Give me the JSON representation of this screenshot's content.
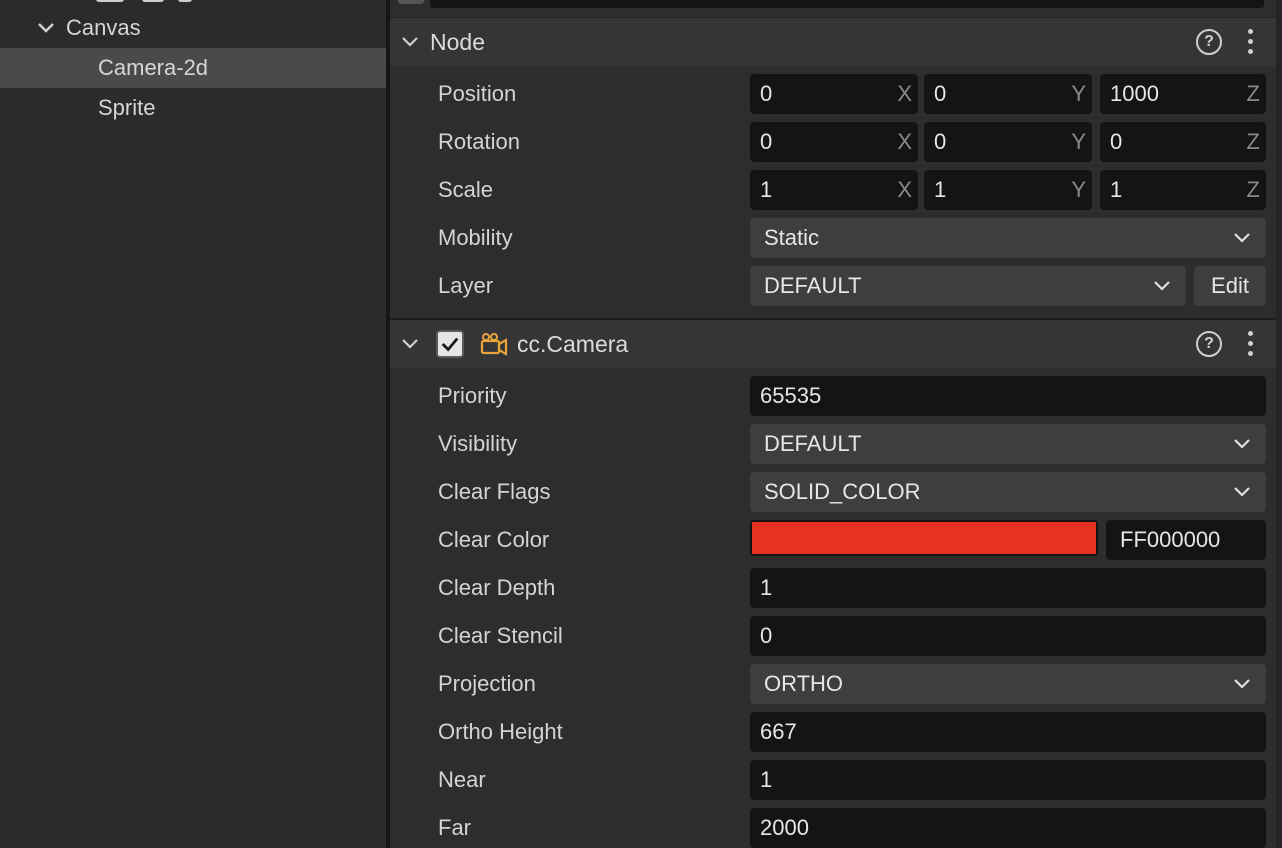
{
  "hierarchy": {
    "items": [
      {
        "label": "Canvas",
        "expanded": true
      },
      {
        "label": "Camera-2d",
        "selected": true
      },
      {
        "label": "Sprite"
      }
    ]
  },
  "node": {
    "title": "Node",
    "help_icon": "?",
    "position": {
      "label": "Position",
      "x": "0",
      "y": "0",
      "z": "1000"
    },
    "rotation": {
      "label": "Rotation",
      "x": "0",
      "y": "0",
      "z": "0"
    },
    "scale": {
      "label": "Scale",
      "x": "1",
      "y": "1",
      "z": "1"
    },
    "axes": {
      "x": "X",
      "y": "Y",
      "z": "Z"
    },
    "mobility": {
      "label": "Mobility",
      "value": "Static"
    },
    "layer": {
      "label": "Layer",
      "value": "DEFAULT",
      "edit_label": "Edit"
    }
  },
  "camera": {
    "title": "cc.Camera",
    "help_icon": "?",
    "enabled": true,
    "priority": {
      "label": "Priority",
      "value": "65535"
    },
    "visibility": {
      "label": "Visibility",
      "value": "DEFAULT"
    },
    "clear_flags": {
      "label": "Clear Flags",
      "value": "SOLID_COLOR"
    },
    "clear_color": {
      "label": "Clear Color",
      "hex": "FF000000",
      "swatch": "#e8321f"
    },
    "clear_depth": {
      "label": "Clear Depth",
      "value": "1"
    },
    "clear_stencil": {
      "label": "Clear Stencil",
      "value": "0"
    },
    "projection": {
      "label": "Projection",
      "value": "ORTHO"
    },
    "ortho_height": {
      "label": "Ortho Height",
      "value": "667"
    },
    "near": {
      "label": "Near",
      "value": "1"
    },
    "far": {
      "label": "Far",
      "value": "2000"
    }
  },
  "icons": {
    "expand": "chevron-down-icon",
    "help": "help-icon",
    "more": "more-vertical-icon",
    "camera": "camera-icon",
    "check": "checkmark-icon"
  },
  "colors": {
    "accent_camera_icon": "#e8a33c",
    "selection": "#4a4a4a"
  }
}
